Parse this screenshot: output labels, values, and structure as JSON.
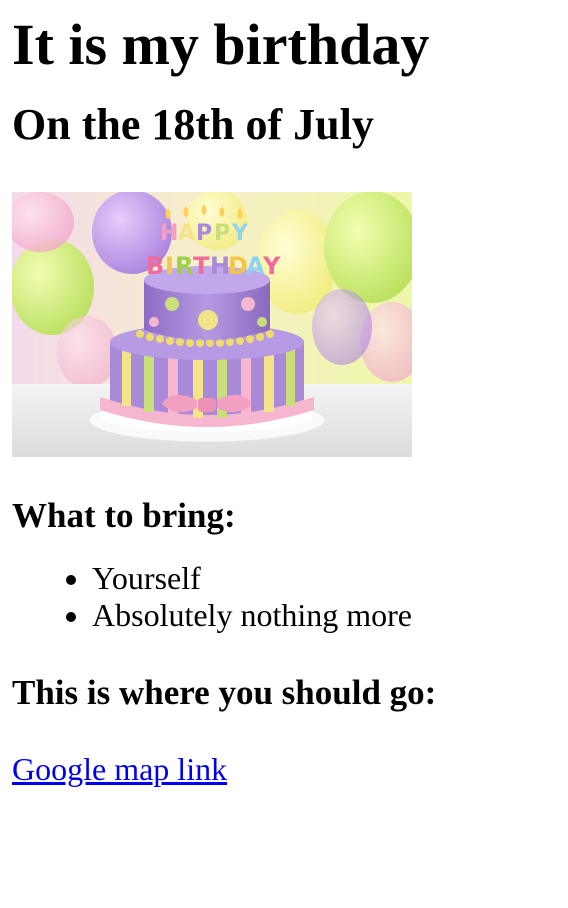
{
  "page": {
    "title": "It is my birthday",
    "subtitle": "On the 18th of July"
  },
  "image": {
    "subject": "cake-image",
    "cake_text_line1": "HAPPY",
    "cake_text_line2": "BIRTHDAY"
  },
  "bring": {
    "heading": "What to bring:",
    "items": [
      "Yourself",
      "Absolutely nothing more"
    ]
  },
  "location": {
    "heading": "This is where you should go:",
    "link_text": "Google map link"
  },
  "colors": {
    "link": "#0000ee",
    "text": "#000000",
    "background": "#ffffff"
  }
}
